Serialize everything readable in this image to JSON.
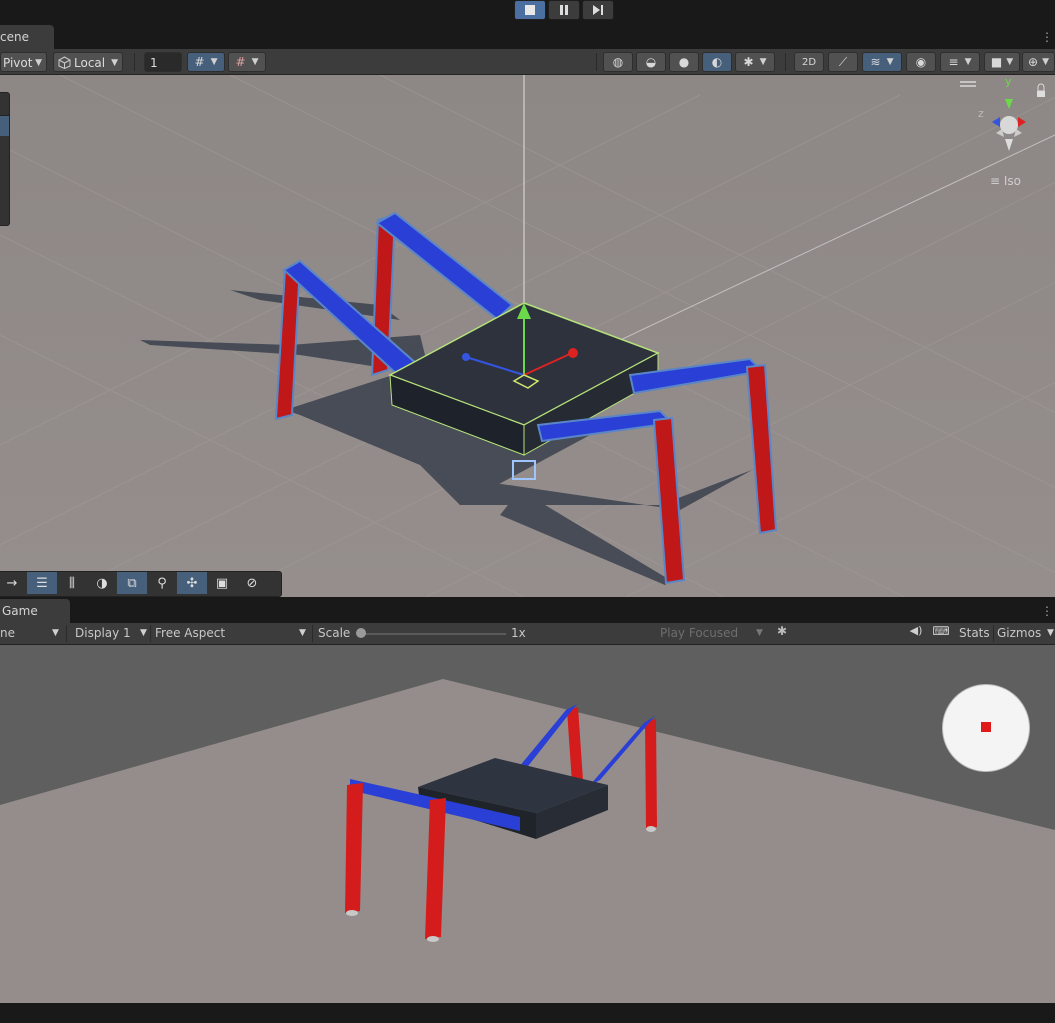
{
  "play_controls": {
    "stop_icon": "stop-icon",
    "pause_icon": "pause-icon",
    "step_icon": "step-icon"
  },
  "scene_tab": {
    "label": "cene"
  },
  "scene_toolbar": {
    "pivot_label": "Pivot",
    "local_label": "Local",
    "grid_size": "1",
    "iso_label": "Iso"
  },
  "scene_orientation": {
    "y_label": "y",
    "z_label": "z"
  },
  "overlay_icons": [
    "move-icon",
    "sliders-icon",
    "bars-icon",
    "circle-icon",
    "layers-icon",
    "magnifier-icon",
    "transform-icon",
    "camera-icon",
    "compass-icon"
  ],
  "game_tab": {
    "label": "Game"
  },
  "game_toolbar": {
    "view_label": "ne",
    "display_label": "Display 1",
    "aspect_label": "Free Aspect",
    "scale_label": "Scale",
    "scale_value": 0.0,
    "scale_text": "1x",
    "play_mode_label": "Play Focused",
    "stats_label": "Stats",
    "gizmos_label": "Gizmos"
  },
  "colors": {
    "accent": "#46607c",
    "leg_red": "#d41c1c",
    "leg_blue": "#2a3fd6",
    "body": "#2f3540",
    "floor": "#938c8a"
  }
}
